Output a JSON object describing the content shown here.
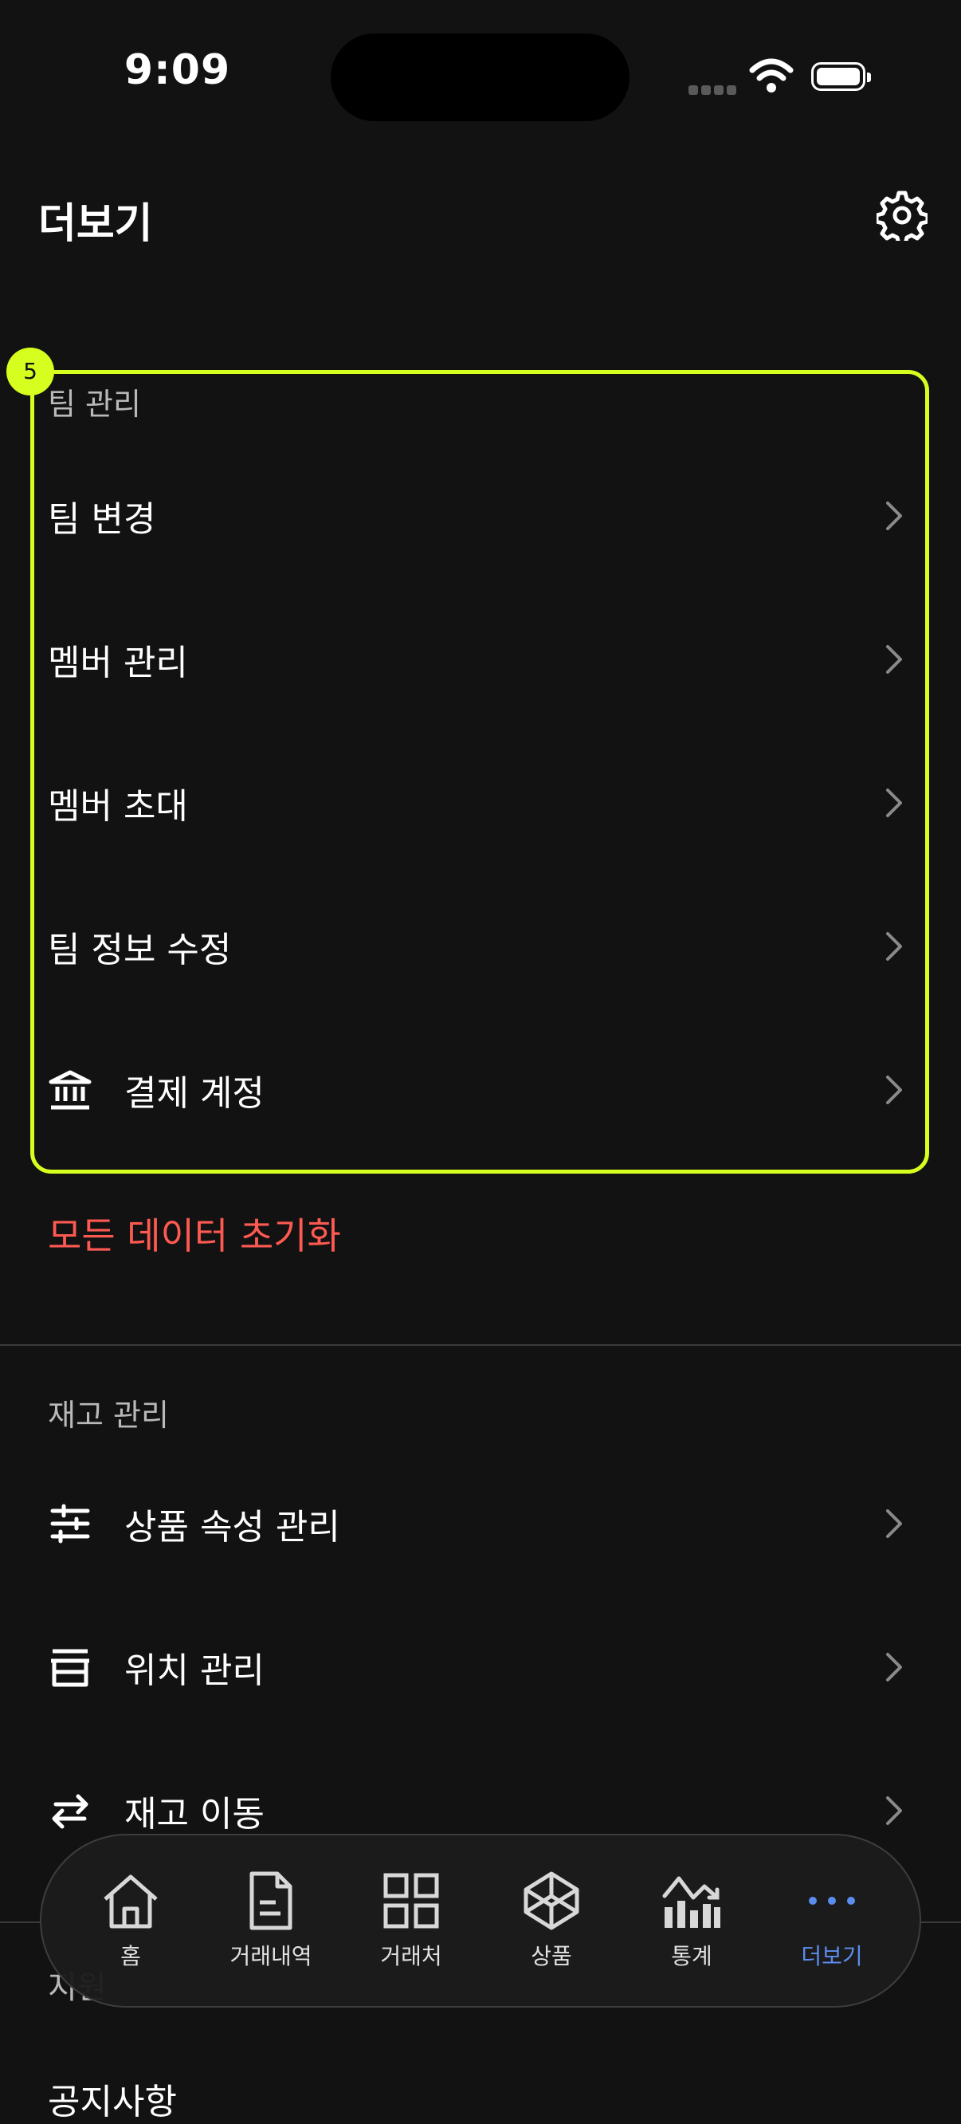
{
  "status_bar": {
    "time": "9:09"
  },
  "header": {
    "title": "더보기"
  },
  "highlight": {
    "badge": "5"
  },
  "team_section": {
    "label": "팀 관리",
    "items": [
      {
        "label": "팀 변경"
      },
      {
        "label": "멤버 관리"
      },
      {
        "label": "멤버 초대"
      },
      {
        "label": "팀 정보 수정"
      },
      {
        "label": "결제 계정",
        "icon": "bank-icon"
      }
    ]
  },
  "reset_label": "모든 데이터 초기화",
  "inventory_section": {
    "label": "재고 관리",
    "items": [
      {
        "label": "상품 속성 관리",
        "icon": "sliders-icon"
      },
      {
        "label": "위치 관리",
        "icon": "store-icon"
      },
      {
        "label": "재고 이동",
        "icon": "swap-icon"
      }
    ]
  },
  "next_section_label": "지원",
  "next_row_label": "공지사항",
  "tab_bar": {
    "tabs": [
      {
        "label": "홈",
        "icon": "home-icon"
      },
      {
        "label": "거래내역",
        "icon": "document-icon"
      },
      {
        "label": "거래처",
        "icon": "grid-icon"
      },
      {
        "label": "상품",
        "icon": "box-icon"
      },
      {
        "label": "통계",
        "icon": "chart-icon"
      },
      {
        "label": "더보기",
        "icon": "more-icon",
        "active": true
      }
    ]
  },
  "colors": {
    "background": "#121212",
    "highlight": "#d6ff1f",
    "danger": "#ff5a52",
    "active_tab": "#5b8def"
  }
}
